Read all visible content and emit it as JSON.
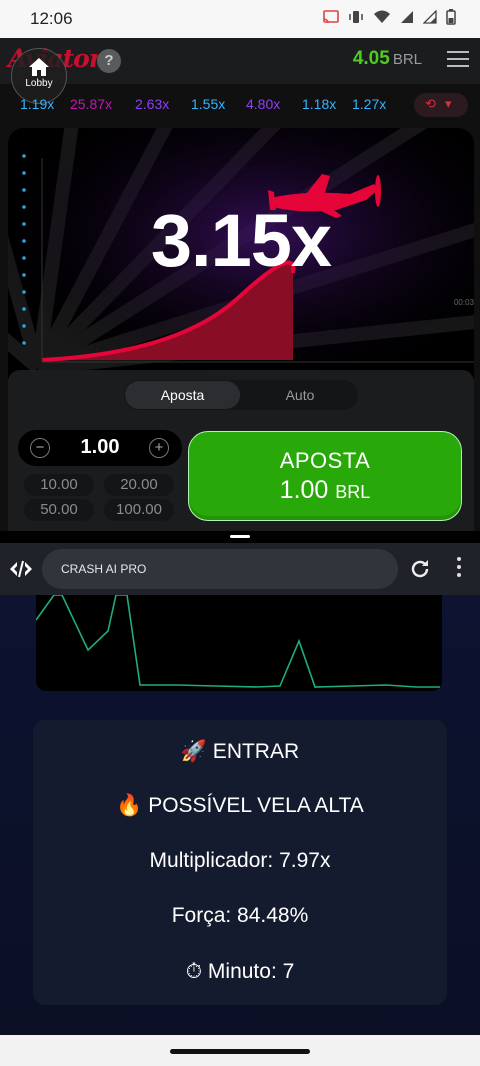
{
  "status_bar": {
    "time": "12:06",
    "icons": [
      "cast-icon",
      "vibrate-icon",
      "wifi-icon",
      "signal-icon",
      "signal-icon",
      "battery-icon"
    ]
  },
  "game": {
    "logo": "Aviator",
    "lobby_label": "Lobby",
    "help_label": "?",
    "balance_value": "4.05",
    "balance_currency": "BRL",
    "history": [
      {
        "value": "1.19x",
        "color": "#34b4ff"
      },
      {
        "value": "25.87x",
        "color": "#c017b4"
      },
      {
        "value": "2.63x",
        "color": "#913ef8"
      },
      {
        "value": "1.55x",
        "color": "#34b4ff"
      },
      {
        "value": "4.80x",
        "color": "#913ef8"
      },
      {
        "value": "1.18x",
        "color": "#34b4ff"
      },
      {
        "value": "1.27x",
        "color": "#34b4ff"
      }
    ],
    "multiplier": "3.15x",
    "timer_fragment": "00:03",
    "tabs": {
      "bet": "Aposta",
      "auto": "Auto"
    },
    "bet_amount": "1.00",
    "quick_amounts": [
      "10.00",
      "20.00",
      "50.00",
      "100.00"
    ],
    "bet_button": {
      "label": "APOSTA",
      "amount": "1.00",
      "currency": "BRL"
    },
    "colors": {
      "accent_red": "#e50539",
      "button_green": "#28a909",
      "balance_green": "#4ecc20"
    }
  },
  "browser": {
    "title": "CRASH AI PRO"
  },
  "signal": {
    "enter": "🚀 ENTRAR",
    "alert": "🔥 POSSÍVEL VELA ALTA",
    "multiplier": "Multiplicador: 7.97x",
    "strength": "Força: 84.48%",
    "minute": "⏱ Minuto: 7"
  }
}
